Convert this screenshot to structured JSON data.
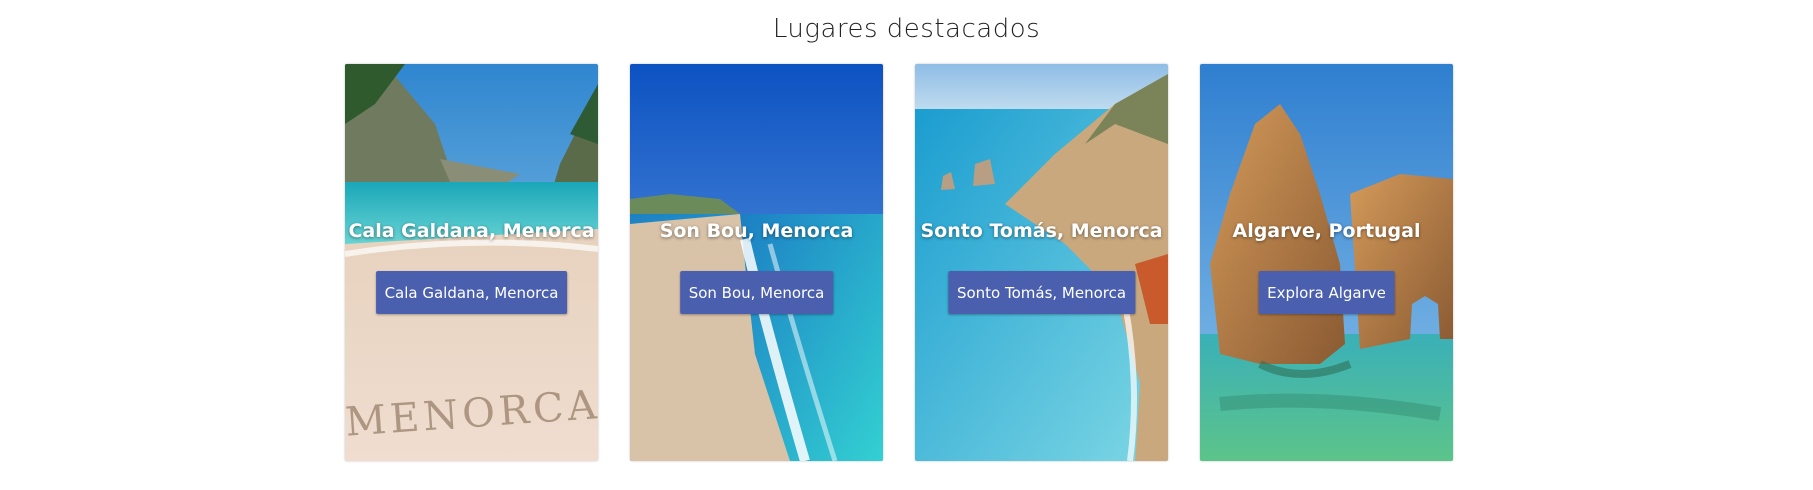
{
  "section": {
    "title": "Lugares destacados"
  },
  "cards": [
    {
      "title": "Cala Galdana, Menorca",
      "button_label": "Cala Galdana, Menorca",
      "image_text": "MENORCA"
    },
    {
      "title": "Son Bou, Menorca",
      "button_label": "Son Bou, Menorca"
    },
    {
      "title": "Sonto Tomás, Menorca",
      "button_label": "Sonto Tomás, Menorca"
    },
    {
      "title": "Algarve, Portugal",
      "button_label": "Explora Algarve"
    }
  ],
  "colors": {
    "button_bg": "#4a5fae",
    "button_text": "#ffffff",
    "title_text": "#222222"
  }
}
